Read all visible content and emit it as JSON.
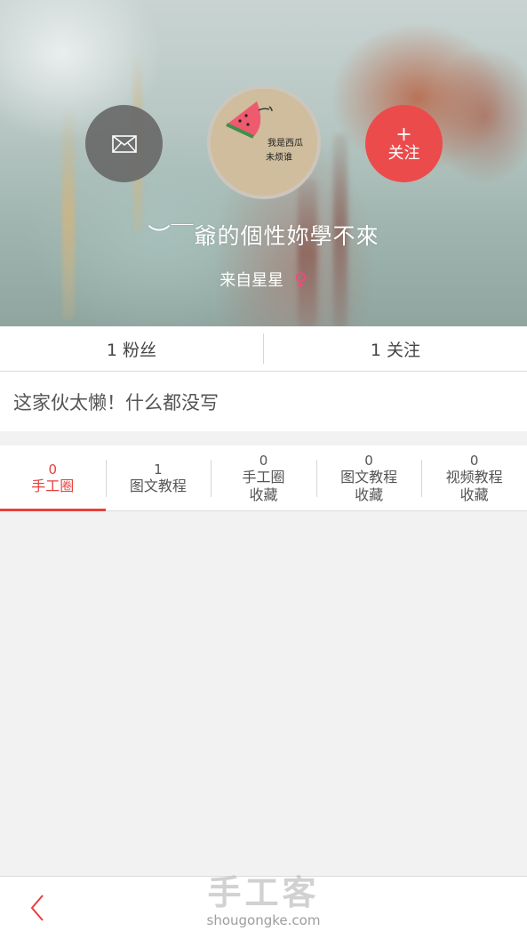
{
  "profile": {
    "username": "︶￣爺的個性妳學不來",
    "location": "来自星星",
    "gender_symbol": "♀",
    "avatar_text": [
      "我是西瓜",
      "未烦谁"
    ]
  },
  "actions": {
    "follow_plus": "+",
    "follow_label": "关注"
  },
  "stats": {
    "fans": "1 粉丝",
    "following": "1 关注"
  },
  "bio": "这家伙太懒！什么都没写",
  "tabs": [
    {
      "count": "0",
      "label": "手工圈",
      "active": true
    },
    {
      "count": "1",
      "label": "图文教程"
    },
    {
      "count": "0",
      "label": "手工圈\n收藏"
    },
    {
      "count": "0",
      "label": "图文教程\n收藏"
    },
    {
      "count": "0",
      "label": "视频教程\n收藏"
    }
  ],
  "watermark": {
    "title": "手工客",
    "url": "shougongke.com"
  },
  "colors": {
    "accent": "#e6403d",
    "follow_button": "#ec4b4b",
    "message_button": "#696969",
    "gender": "#f04a7c"
  },
  "icons": {
    "message": "envelope-icon",
    "back": "chevron-left-icon",
    "gender": "female-symbol-icon"
  }
}
